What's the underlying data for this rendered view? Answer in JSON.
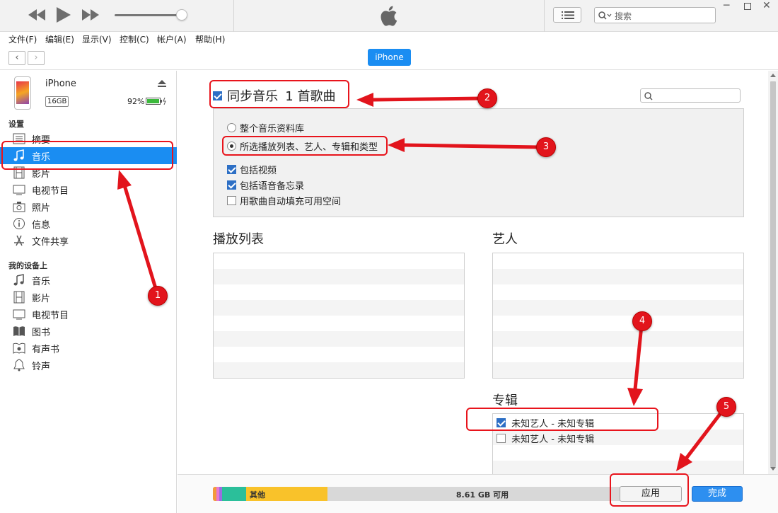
{
  "topbar": {
    "search_placeholder": "搜索"
  },
  "menu": [
    "文件(F)",
    "编辑(E)",
    "显示(V)",
    "控制(C)",
    "帐户(A)",
    "帮助(H)"
  ],
  "nav": {
    "device_pill": "iPhone"
  },
  "device": {
    "name": "iPhone",
    "capacity": "16GB",
    "battery": "92%"
  },
  "sidebar": {
    "settings_title": "设置",
    "settings_items": [
      "摘要",
      "音乐",
      "影片",
      "电视节目",
      "照片",
      "信息",
      "文件共享"
    ],
    "ondevice_title": "我的设备上",
    "ondevice_items": [
      "音乐",
      "影片",
      "电视节目",
      "图书",
      "有声书",
      "铃声"
    ]
  },
  "sync": {
    "title": "同步音乐",
    "count": "1 首歌曲",
    "opt_entire": "整个音乐资料库",
    "opt_selected": "所选播放列表、艺人、专辑和类型",
    "include_video": "包括视频",
    "include_memos": "包括语音备忘录",
    "autofill": "用歌曲自动填充可用空间"
  },
  "sections": {
    "playlists": "播放列表",
    "artists": "艺人",
    "albums": "专辑"
  },
  "albums": [
    {
      "label": "未知艺人 - 未知专辑",
      "checked": true
    },
    {
      "label": "未知艺人 - 未知专辑",
      "checked": false
    }
  ],
  "storage": {
    "other_label": "其他",
    "free_label": "8.61 GB 可用"
  },
  "buttons": {
    "apply": "应用",
    "done": "完成"
  },
  "annotations": [
    "1",
    "2",
    "3",
    "4",
    "5"
  ]
}
